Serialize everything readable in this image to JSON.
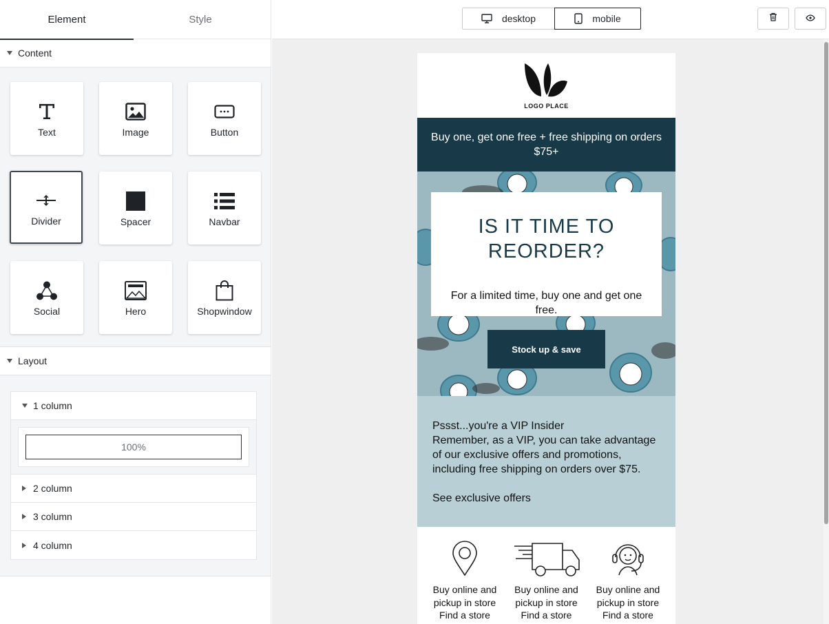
{
  "sidebar": {
    "tabs": [
      {
        "label": "Element",
        "active": true
      },
      {
        "label": "Style",
        "active": false
      }
    ],
    "content": {
      "title": "Content",
      "blocks": [
        {
          "label": "Text",
          "icon": "text-icon"
        },
        {
          "label": "Image",
          "icon": "image-icon"
        },
        {
          "label": "Button",
          "icon": "button-icon"
        },
        {
          "label": "Divider",
          "icon": "divider-icon",
          "selected": true
        },
        {
          "label": "Spacer",
          "icon": "spacer-icon"
        },
        {
          "label": "Navbar",
          "icon": "navbar-icon"
        },
        {
          "label": "Social",
          "icon": "social-icon"
        },
        {
          "label": "Hero",
          "icon": "hero-icon"
        },
        {
          "label": "Shopwindow",
          "icon": "shopwindow-icon"
        }
      ]
    },
    "layout": {
      "title": "Layout",
      "rows": [
        {
          "label": "1 column",
          "expanded": true,
          "cells": [
            "100%"
          ]
        },
        {
          "label": "2 column",
          "expanded": false
        },
        {
          "label": "3 column",
          "expanded": false
        },
        {
          "label": "4 column",
          "expanded": false
        }
      ]
    }
  },
  "toolbar": {
    "desktop_label": "desktop",
    "mobile_label": "mobile",
    "active_view": "mobile",
    "delete_icon": "trash-icon",
    "preview_icon": "eye-icon"
  },
  "email": {
    "logo_text": "LOGO PLACE",
    "promo_text": "Buy one, get one free + free shipping on orders $75+",
    "hero": {
      "title": "IS IT TIME TO REORDER?",
      "subtitle": "For a limited time, buy one and get one free.",
      "button_label": "Stock up & save"
    },
    "vip": {
      "heading": "Pssst...you're a VIP Insider",
      "body": "Remember, as a VIP, you can take advantage of our exclusive offers and promotions, including free shipping on orders over $75.",
      "link": "See exclusive offers"
    },
    "features": [
      {
        "icon": "map-pin-icon",
        "text": "Buy online and pickup in store",
        "link": "Find a store"
      },
      {
        "icon": "delivery-truck-icon",
        "text": "Buy online and pickup in store",
        "link": "Find a store"
      },
      {
        "icon": "support-agent-icon",
        "text": "Buy online and pickup in store",
        "link": "Find a store"
      }
    ]
  },
  "colors": {
    "brand_dark": "#183a48",
    "vip_bg": "#b7cfd5",
    "hero_bg": "#9cb9c2",
    "panel_bg": "#f4f5f7",
    "canvas_bg": "#efefef"
  }
}
